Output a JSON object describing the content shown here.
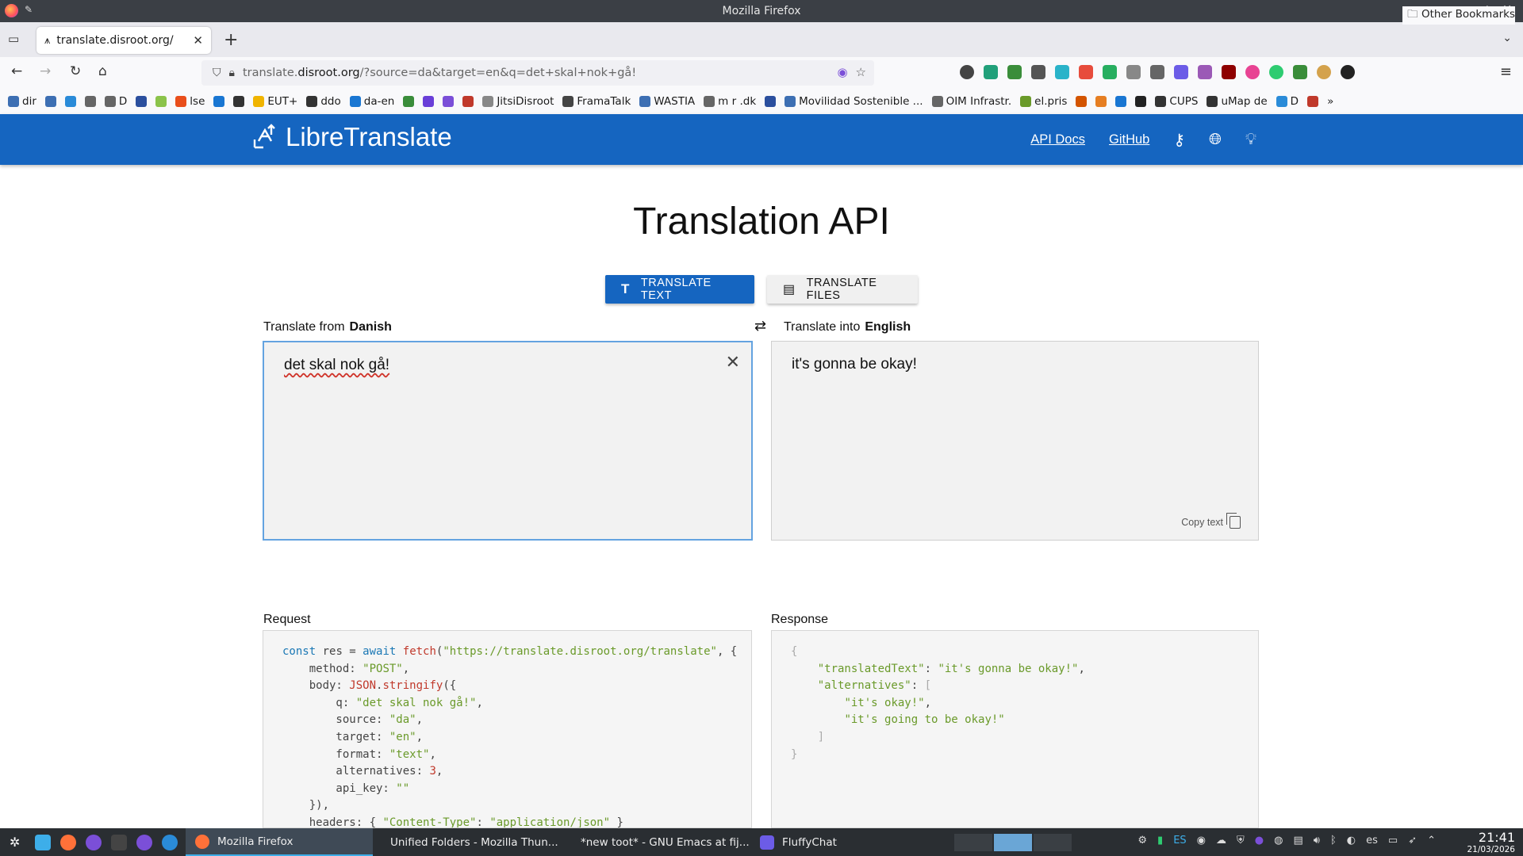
{
  "window": {
    "title": "Mozilla Firefox"
  },
  "tab": {
    "title": "translate.disroot.org/"
  },
  "url": {
    "domain_prefix": "translate.",
    "domain": "disroot.org",
    "path": "/?source=da&target=en&q=det+skal+nok+gå!"
  },
  "bookmarks": [
    {
      "label": "dir",
      "color": "#3d6fb3"
    },
    {
      "label": "",
      "color": "#3d6fb3"
    },
    {
      "label": "",
      "color": "#2a8bd8"
    },
    {
      "label": "",
      "color": "#666666"
    },
    {
      "label": "D",
      "color": "#666666"
    },
    {
      "label": "",
      "color": "#2b4f9e"
    },
    {
      "label": "",
      "color": "#8bc34a"
    },
    {
      "label": "lse",
      "color": "#e94e1b"
    },
    {
      "label": "",
      "color": "#1976d2"
    },
    {
      "label": "",
      "color": "#333333"
    },
    {
      "label": "EUT+",
      "color": "#f0b400"
    },
    {
      "label": "ddo",
      "color": "#333333"
    },
    {
      "label": "da-en",
      "color": "#1976d2"
    },
    {
      "label": "",
      "color": "#3a8d3a"
    },
    {
      "label": "",
      "color": "#6a3fd8"
    },
    {
      "label": "",
      "color": "#7b4fd8"
    },
    {
      "label": "",
      "color": "#c0392b"
    },
    {
      "label": "JitsiDisroot",
      "color": "#888888"
    },
    {
      "label": "FramaTalk",
      "color": "#444444"
    },
    {
      "label": "WASTIA",
      "color": "#3d6fb3"
    },
    {
      "label": "m r .dk",
      "color": "#666666"
    },
    {
      "label": "",
      "color": "#2b4f9e"
    },
    {
      "label": "Movilidad Sostenible ...",
      "color": "#3d6fb3"
    },
    {
      "label": "OIM Infrastr.",
      "color": "#666666"
    },
    {
      "label": "el.pris",
      "color": "#6a9a2a"
    },
    {
      "label": "",
      "color": "#d35400"
    },
    {
      "label": "",
      "color": "#e67e22"
    },
    {
      "label": "",
      "color": "#1976d2"
    },
    {
      "label": "",
      "color": "#222222"
    },
    {
      "label": "CUPS",
      "color": "#333333"
    },
    {
      "label": "uMap de",
      "color": "#333333"
    },
    {
      "label": "D",
      "color": "#2a8bd8"
    },
    {
      "label": "",
      "color": "#c0392b"
    }
  ],
  "other_bookmarks": "Other Bookmarks",
  "header": {
    "brand": "LibreTranslate",
    "api_docs": "API Docs",
    "github": "GitHub"
  },
  "main": {
    "title": "Translation API",
    "translate_text": "TRANSLATE TEXT",
    "translate_files": "TRANSLATE FILES",
    "from_prefix": "Translate from",
    "from_lang": "Danish",
    "into_prefix": "Translate into",
    "into_lang": "English",
    "source_text": "det skal nok gå!",
    "translated_text": "it's gonna be okay!",
    "copy_text": "Copy text",
    "request_label": "Request",
    "response_label": "Response"
  },
  "taskbar": {
    "items": [
      "Mozilla Firefox",
      "Unified Folders - Mozilla Thun...",
      "*new toot* - GNU Emacs at fij...",
      "FluffyChat"
    ],
    "tray_lang_short": "ES",
    "tray_lang": "es",
    "time": "21:41",
    "date": "21/03/2026"
  },
  "colors": {
    "accent": "#1565c0",
    "code_string": "#6a9a2a",
    "code_keyword": "#1b78b5"
  }
}
